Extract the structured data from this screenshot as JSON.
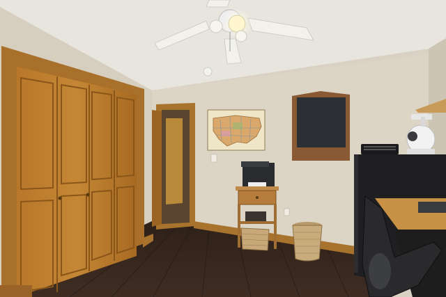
{
  "scene": {
    "description_free": true,
    "colors": {
      "ceiling": "#e9e6df",
      "wall_left": "#d8d1c2",
      "wall_back": "#ddd6c6",
      "wall_right": "#cfc7b6",
      "floor": "#3a2a22",
      "wood": "#b7792c",
      "wood_dark": "#8a5518",
      "trim": "#a8732c",
      "blackboard": "#2c2f33",
      "cabinet": "#1f1f21"
    }
  }
}
